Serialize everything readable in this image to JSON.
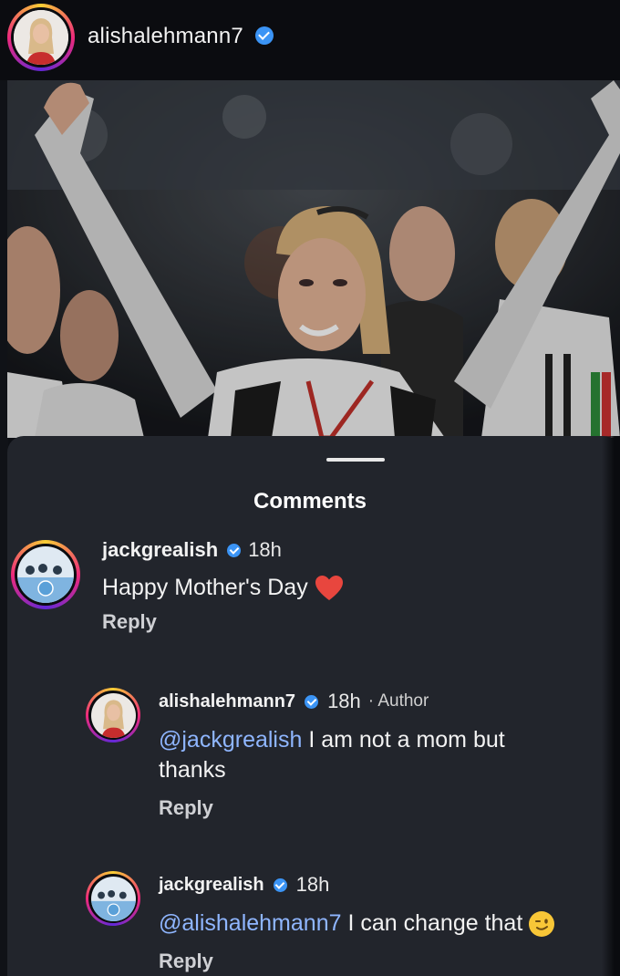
{
  "post": {
    "username": "alishalehmann7"
  },
  "comments_sheet": {
    "title": "Comments",
    "comments": [
      {
        "user": "jackgrealish",
        "time": "18h",
        "text": "Happy Mother's Day",
        "emoji": "heart-emoji",
        "reply_label": "Reply"
      },
      {
        "user": "alishalehmann7",
        "time": "18h",
        "author_label": "· Author",
        "mention": "@jackgrealish",
        "text_line1": " I am not a mom but",
        "text_line2": "thanks",
        "reply_label": "Reply"
      },
      {
        "user": "jackgrealish",
        "time": "18h",
        "mention": "@alishalehmann7",
        "text": " I can change that",
        "emoji": "winking-face-emoji",
        "reply_label": "Reply"
      }
    ]
  },
  "colors": {
    "verified_badge": "#3b94f5",
    "mention": "#8fb6ff",
    "sheet_background": "#22252c",
    "header_background": "#0b0c10"
  }
}
